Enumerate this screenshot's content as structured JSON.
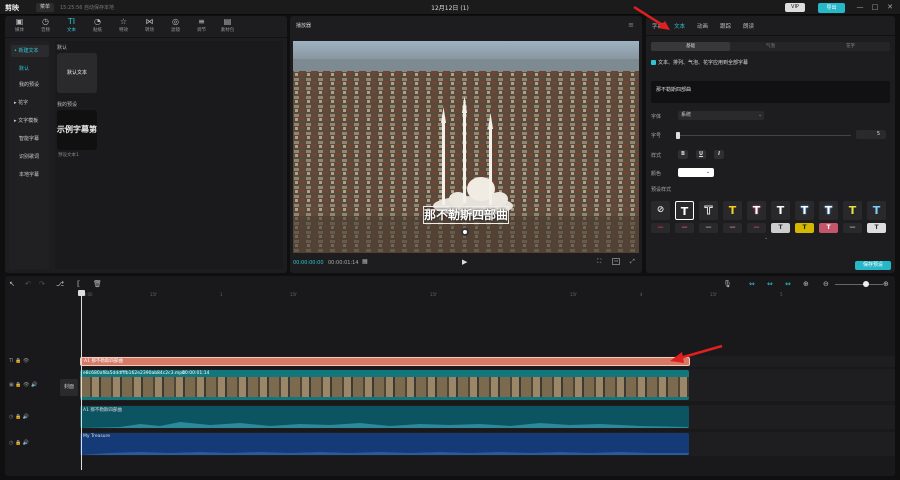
{
  "titlebar": {
    "logo": "剪映",
    "menu": "菜单",
    "autosave": "15:25:56 自动保存本地",
    "title": "12月12日 (1)",
    "vip": "VIP",
    "export": "导出",
    "min": "—",
    "max": "□",
    "close": "✕"
  },
  "tool_tabs": [
    {
      "icon": "▣",
      "label": "媒体"
    },
    {
      "icon": "◷",
      "label": "音频"
    },
    {
      "icon": "TI",
      "label": "文本"
    },
    {
      "icon": "◔",
      "label": "贴纸"
    },
    {
      "icon": "☆",
      "label": "特效"
    },
    {
      "icon": "⋈",
      "label": "转场"
    },
    {
      "icon": "◎",
      "label": "滤镜"
    },
    {
      "icon": "≡",
      "label": "调节"
    },
    {
      "icon": "▤",
      "label": "素材包"
    }
  ],
  "side_nav": [
    "• 新建文本",
    "默认",
    "我的预设",
    "▸ 花字",
    "▸ 文字模板",
    "智能字幕",
    "识别歌词",
    "本地字幕"
  ],
  "content": {
    "default_label": "默认",
    "default_card": "默认文本",
    "my_preset_label": "我的预设",
    "preset_card": "示例字幕第一",
    "preset_caption": "预设文本1"
  },
  "player": {
    "title": "播放器",
    "subtitle": "那不勒斯四部曲",
    "time_current": "00:00:00:00",
    "time_total": "00:00:01:14"
  },
  "props": {
    "tabs": [
      "字幕",
      "文本",
      "动画",
      "跟踪",
      "朗读"
    ],
    "sub_tabs": [
      "基础",
      "气泡",
      "花字"
    ],
    "apply_all": "文本、排列、气泡、花字应用到全部字幕",
    "text_value": "那不勒斯四部曲",
    "font_label": "字体",
    "font_value": "系统",
    "size_label": "字号",
    "size_value": "5",
    "style_label": "样式",
    "color_label": "颜色",
    "presets_label": "预设样式",
    "save_preset": "保存预设"
  },
  "timeline": {
    "ruler": [
      "00:00",
      "15f",
      "1",
      "15f",
      "2",
      "15f",
      "3",
      "15f",
      "4",
      "15f",
      "5"
    ],
    "text_clip": "A1 那不勒斯四部曲",
    "video_clip": "e8c680af8a5dddfffb162e2390ab84c2c3.mp4",
    "video_duration": "00:00:01:14",
    "audio_clip_1": "A1 那不勒斯四部曲",
    "audio_clip_2": "My Treasure",
    "cover": "封面"
  },
  "colors": {
    "accent": "#2ec4d4",
    "text_clip": "#d67a66",
    "video_clip": "#11777d",
    "audio_1": "#0c5462",
    "audio_2": "#143b78",
    "arrow": "#e01f1f"
  }
}
